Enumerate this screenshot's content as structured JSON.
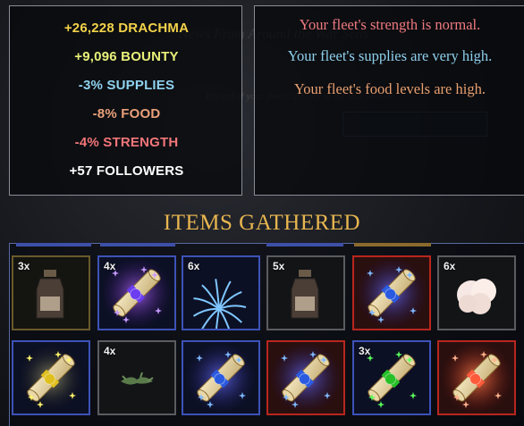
{
  "rewards": {
    "drachma": "+26,228 DRACHMA",
    "bounty": "+9,096 BOUNTY",
    "supplies": "-3% SUPPLIES",
    "food": "-8% FOOD",
    "strength": "-4% STRENGTH",
    "followers": "+57 FOLLOWERS"
  },
  "reports": {
    "strength": "Your fleet's strength is normal.",
    "supplies": "Your fleet's supplies are very high.",
    "food": "Your fleet's food levels are high."
  },
  "items_title": "ITEMS GATHERED",
  "items": [
    {
      "count": "3x",
      "icon": "bottle-icon"
    },
    {
      "count": "4x",
      "icon": "scroll-purple-icon"
    },
    {
      "count": "6x",
      "icon": "coral-icon"
    },
    {
      "count": "5x",
      "icon": "bottle-icon"
    },
    {
      "count": "",
      "icon": "scroll-blue-icon"
    },
    {
      "count": "6x",
      "icon": "wool-icon"
    },
    {
      "count": "",
      "icon": "scroll-gold-icon"
    },
    {
      "count": "4x",
      "icon": "seaweed-icon"
    },
    {
      "count": "",
      "icon": "scroll-blue-icon"
    },
    {
      "count": "",
      "icon": "scroll-blue-icon"
    },
    {
      "count": "3x",
      "icon": "scroll-green-icon"
    },
    {
      "count": "",
      "icon": "scroll-red-icon"
    }
  ],
  "colors": {
    "drachma": "#f3d24a",
    "bounty": "#e9f07a",
    "supplies": "#8fd2ef",
    "food": "#e9a07a",
    "strength": "#f2767a",
    "followers": "#ffffff",
    "report_strength": "#ee7a80",
    "report_supplies": "#8fd0ee",
    "report_food": "#e9a070",
    "title": "#e8b650"
  }
}
